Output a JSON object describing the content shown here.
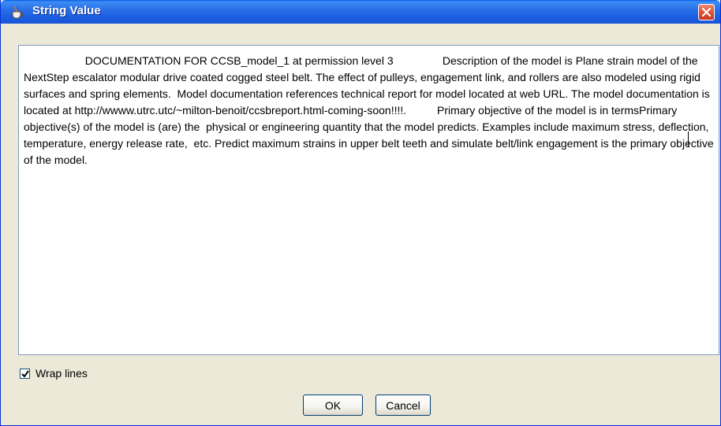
{
  "window": {
    "title": "String Value",
    "icon": "java-cup-icon",
    "close_icon": "close-x-icon"
  },
  "editor": {
    "text": "                    DOCUMENTATION FOR CCSB_model_1 at permission level 3                Description of the model is Plane strain model of the NextStep escalator modular drive coated cogged steel belt. The effect of pulleys, engagement link, and rollers are also modeled using rigid surfaces and spring elements.  Model documentation references technical report for model located at web URL. The model documentation is located at http://wwww.utrc.utc/~milton-benoit/ccsbreport.html-coming-soon!!!!.          Primary objective of the model is in termsPrimary objective(s) of the model is (are) the  physical or engineering quantity that the model predicts. Examples include maximum stress, deflection, temperature, energy release rate,  etc. Predict maximum strains in upper belt teeth and simulate belt/link engagement is the primary objective of the model."
  },
  "options": {
    "wrap_lines_label": "Wrap lines",
    "wrap_lines_checked": true
  },
  "buttons": {
    "ok_label": "OK",
    "cancel_label": "Cancel"
  },
  "colors": {
    "titlebar": "#1b5fe0",
    "close_button": "#e0543a",
    "dialog_background": "#ece9d8"
  }
}
